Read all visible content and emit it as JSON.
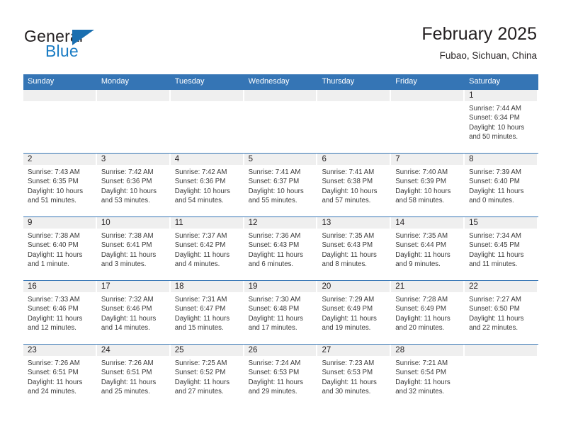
{
  "brand": {
    "word_one": "General",
    "word_two": "Blue",
    "triangle_color": "#1a6fb0",
    "general_color": "#231f20",
    "blue_color": "#1a7cc4"
  },
  "header": {
    "title": "February 2025",
    "subtitle": "Fubao, Sichuan, China"
  },
  "theme": {
    "header_blue": "#3575b5",
    "day_band_gray": "#efefef",
    "text_dark": "#231f20",
    "text_body": "#3a3a3a"
  },
  "calendar": {
    "weekdays": [
      "Sunday",
      "Monday",
      "Tuesday",
      "Wednesday",
      "Thursday",
      "Friday",
      "Saturday"
    ],
    "weeks": [
      [
        {
          "day": "",
          "lines": []
        },
        {
          "day": "",
          "lines": []
        },
        {
          "day": "",
          "lines": []
        },
        {
          "day": "",
          "lines": []
        },
        {
          "day": "",
          "lines": []
        },
        {
          "day": "",
          "lines": []
        },
        {
          "day": "1",
          "lines": [
            "Sunrise: 7:44 AM",
            "Sunset: 6:34 PM",
            "Daylight: 10 hours",
            "and 50 minutes."
          ]
        }
      ],
      [
        {
          "day": "2",
          "lines": [
            "Sunrise: 7:43 AM",
            "Sunset: 6:35 PM",
            "Daylight: 10 hours",
            "and 51 minutes."
          ]
        },
        {
          "day": "3",
          "lines": [
            "Sunrise: 7:42 AM",
            "Sunset: 6:36 PM",
            "Daylight: 10 hours",
            "and 53 minutes."
          ]
        },
        {
          "day": "4",
          "lines": [
            "Sunrise: 7:42 AM",
            "Sunset: 6:36 PM",
            "Daylight: 10 hours",
            "and 54 minutes."
          ]
        },
        {
          "day": "5",
          "lines": [
            "Sunrise: 7:41 AM",
            "Sunset: 6:37 PM",
            "Daylight: 10 hours",
            "and 55 minutes."
          ]
        },
        {
          "day": "6",
          "lines": [
            "Sunrise: 7:41 AM",
            "Sunset: 6:38 PM",
            "Daylight: 10 hours",
            "and 57 minutes."
          ]
        },
        {
          "day": "7",
          "lines": [
            "Sunrise: 7:40 AM",
            "Sunset: 6:39 PM",
            "Daylight: 10 hours",
            "and 58 minutes."
          ]
        },
        {
          "day": "8",
          "lines": [
            "Sunrise: 7:39 AM",
            "Sunset: 6:40 PM",
            "Daylight: 11 hours",
            "and 0 minutes."
          ]
        }
      ],
      [
        {
          "day": "9",
          "lines": [
            "Sunrise: 7:38 AM",
            "Sunset: 6:40 PM",
            "Daylight: 11 hours",
            "and 1 minute."
          ]
        },
        {
          "day": "10",
          "lines": [
            "Sunrise: 7:38 AM",
            "Sunset: 6:41 PM",
            "Daylight: 11 hours",
            "and 3 minutes."
          ]
        },
        {
          "day": "11",
          "lines": [
            "Sunrise: 7:37 AM",
            "Sunset: 6:42 PM",
            "Daylight: 11 hours",
            "and 4 minutes."
          ]
        },
        {
          "day": "12",
          "lines": [
            "Sunrise: 7:36 AM",
            "Sunset: 6:43 PM",
            "Daylight: 11 hours",
            "and 6 minutes."
          ]
        },
        {
          "day": "13",
          "lines": [
            "Sunrise: 7:35 AM",
            "Sunset: 6:43 PM",
            "Daylight: 11 hours",
            "and 8 minutes."
          ]
        },
        {
          "day": "14",
          "lines": [
            "Sunrise: 7:35 AM",
            "Sunset: 6:44 PM",
            "Daylight: 11 hours",
            "and 9 minutes."
          ]
        },
        {
          "day": "15",
          "lines": [
            "Sunrise: 7:34 AM",
            "Sunset: 6:45 PM",
            "Daylight: 11 hours",
            "and 11 minutes."
          ]
        }
      ],
      [
        {
          "day": "16",
          "lines": [
            "Sunrise: 7:33 AM",
            "Sunset: 6:46 PM",
            "Daylight: 11 hours",
            "and 12 minutes."
          ]
        },
        {
          "day": "17",
          "lines": [
            "Sunrise: 7:32 AM",
            "Sunset: 6:46 PM",
            "Daylight: 11 hours",
            "and 14 minutes."
          ]
        },
        {
          "day": "18",
          "lines": [
            "Sunrise: 7:31 AM",
            "Sunset: 6:47 PM",
            "Daylight: 11 hours",
            "and 15 minutes."
          ]
        },
        {
          "day": "19",
          "lines": [
            "Sunrise: 7:30 AM",
            "Sunset: 6:48 PM",
            "Daylight: 11 hours",
            "and 17 minutes."
          ]
        },
        {
          "day": "20",
          "lines": [
            "Sunrise: 7:29 AM",
            "Sunset: 6:49 PM",
            "Daylight: 11 hours",
            "and 19 minutes."
          ]
        },
        {
          "day": "21",
          "lines": [
            "Sunrise: 7:28 AM",
            "Sunset: 6:49 PM",
            "Daylight: 11 hours",
            "and 20 minutes."
          ]
        },
        {
          "day": "22",
          "lines": [
            "Sunrise: 7:27 AM",
            "Sunset: 6:50 PM",
            "Daylight: 11 hours",
            "and 22 minutes."
          ]
        }
      ],
      [
        {
          "day": "23",
          "lines": [
            "Sunrise: 7:26 AM",
            "Sunset: 6:51 PM",
            "Daylight: 11 hours",
            "and 24 minutes."
          ]
        },
        {
          "day": "24",
          "lines": [
            "Sunrise: 7:26 AM",
            "Sunset: 6:51 PM",
            "Daylight: 11 hours",
            "and 25 minutes."
          ]
        },
        {
          "day": "25",
          "lines": [
            "Sunrise: 7:25 AM",
            "Sunset: 6:52 PM",
            "Daylight: 11 hours",
            "and 27 minutes."
          ]
        },
        {
          "day": "26",
          "lines": [
            "Sunrise: 7:24 AM",
            "Sunset: 6:53 PM",
            "Daylight: 11 hours",
            "and 29 minutes."
          ]
        },
        {
          "day": "27",
          "lines": [
            "Sunrise: 7:23 AM",
            "Sunset: 6:53 PM",
            "Daylight: 11 hours",
            "and 30 minutes."
          ]
        },
        {
          "day": "28",
          "lines": [
            "Sunrise: 7:21 AM",
            "Sunset: 6:54 PM",
            "Daylight: 11 hours",
            "and 32 minutes."
          ]
        },
        {
          "day": "",
          "lines": []
        }
      ]
    ]
  }
}
